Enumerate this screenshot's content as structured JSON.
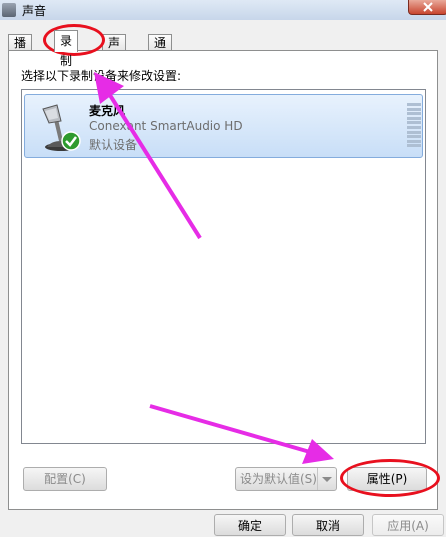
{
  "window": {
    "title": "声音"
  },
  "tabs": [
    {
      "label": "播放"
    },
    {
      "label": "录制",
      "active": true
    },
    {
      "label": "声音"
    },
    {
      "label": "通信"
    }
  ],
  "panel": {
    "instruction": "选择以下录制设备来修改设置:"
  },
  "device": {
    "name": "麦克风",
    "driver": "Conexant SmartAudio HD",
    "status": "默认设备",
    "icon": "microphone-icon",
    "status_icon": "check-icon"
  },
  "buttons": {
    "configure": "配置(C)",
    "set_default": "设为默认值(S)",
    "properties": "属性(P)",
    "ok": "确定",
    "cancel": "取消",
    "apply": "应用(A)"
  },
  "annotations": {
    "highlight_color": "#e8101e",
    "arrow_color": "#e62ce6"
  }
}
